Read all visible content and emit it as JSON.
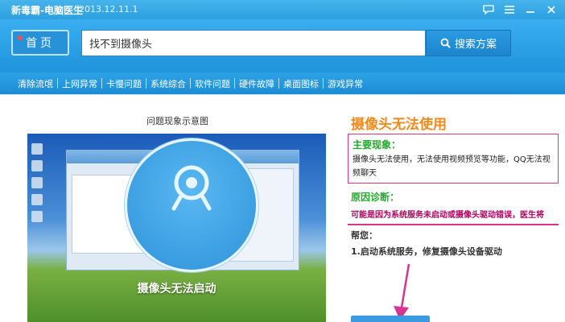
{
  "titlebar": {
    "app_title": "新毒霸-电脑医生",
    "version": "2013.12.11.1",
    "buttons": [
      "chat-bubble-icon",
      "menu-icon",
      "minimize-icon",
      "close-icon"
    ]
  },
  "header": {
    "home_label": "首页",
    "search": {
      "value": "找不到摄像头",
      "placeholder": ""
    },
    "search_button_label": "搜索方案"
  },
  "nav": {
    "items": [
      "清除流氓",
      "上网异常",
      "卡慢问题",
      "系统综合",
      "软件问题",
      "硬件故障",
      "桌面图标",
      "游戏异常"
    ]
  },
  "diagram": {
    "title": "问题现象示意图",
    "caption": "摄像头无法启动"
  },
  "detail": {
    "heading": "摄像头无法使用",
    "symptom_title": "主要现象：",
    "symptom_text": "摄像头无法使用，无法使用视频预览等功能，QQ无法视频聊天",
    "diagnosis_title": "原因诊断：",
    "cause_text": "可能是因为系统服务未启动或摄像头驱动错误，医生将",
    "help_label": "帮您：",
    "solution_text": "1.启动系统服务，修复摄像头设备驱动"
  },
  "colors": {
    "accent_blue": "#2a9be3",
    "heading_orange": "#f08a1a",
    "section_green": "#22a82a",
    "highlight_magenta": "#d63592"
  }
}
